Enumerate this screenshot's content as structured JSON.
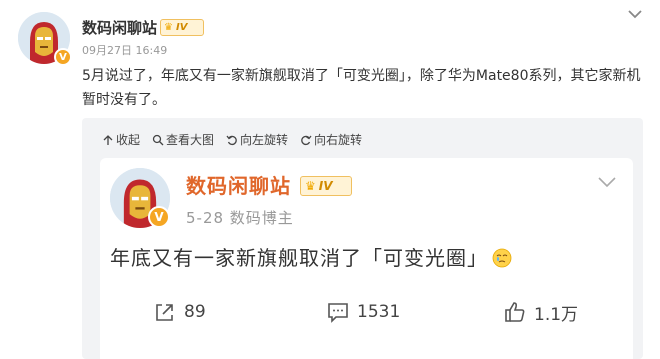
{
  "post": {
    "username": "数码闲聊站",
    "level": "IV",
    "verified_mark": "V",
    "time": "09月27日 16:49",
    "text": "5月说过了，年底又有一家新旗舰取消了「可变光圈」，除了华为Mate80系列，其它家新机暂时没有了。"
  },
  "toolbar": {
    "items": [
      {
        "label": "收起",
        "icon": "arrow-up-icon"
      },
      {
        "label": "查看大图",
        "icon": "zoom-icon"
      },
      {
        "label": "向左旋转",
        "icon": "rotate-left-icon"
      },
      {
        "label": "向右旋转",
        "icon": "rotate-right-icon"
      }
    ]
  },
  "embedded": {
    "username": "数码闲聊站",
    "level": "IV",
    "verified_mark": "V",
    "meta": "5-28  数码博主",
    "text": "年底又有一家新旗舰取消了「可变光圈」",
    "emoji": "crying-face-emoji",
    "actions": {
      "share_count": "89",
      "comment_count": "1531",
      "like_count": "1.1万"
    }
  },
  "colors": {
    "name_orange": "#e0672b",
    "badge_gold": "#f5a623",
    "card_bg": "#f2f3f5"
  }
}
